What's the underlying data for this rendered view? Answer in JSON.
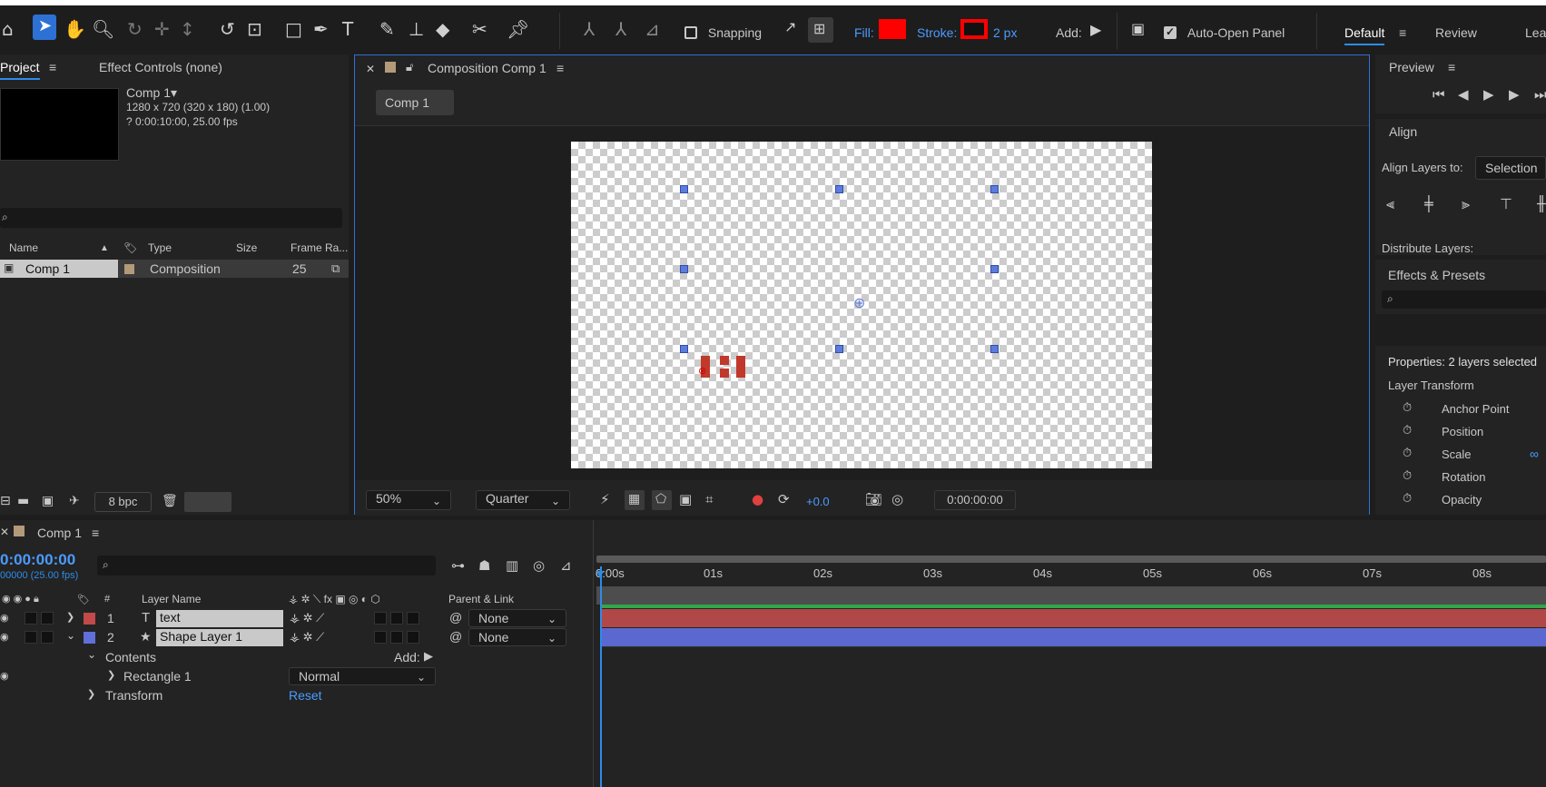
{
  "toolbar": {
    "snapping_label": "Snapping",
    "fill_label": "Fill:",
    "fill_color": "#ff0000",
    "stroke_label": "Stroke:",
    "stroke_width": "2 px",
    "add_label": "Add:",
    "auto_open_label": "Auto-Open Panel",
    "workspaces": [
      "Default",
      "Review",
      "Lea"
    ]
  },
  "project": {
    "tab_project": "Project",
    "tab_effects": "Effect Controls (none)",
    "comp_name": "Comp 1",
    "comp_info1": "1280 x 720  (320 x 180) (1.00)",
    "comp_info2": "? 0:00:10:00, 25.00 fps",
    "columns": [
      "Name",
      "Type",
      "Size",
      "Frame Ra..."
    ],
    "item": {
      "name": "Comp 1",
      "type": "Composition",
      "size": "",
      "fps": "25"
    },
    "bpc": "8 bpc"
  },
  "composition": {
    "tab": "Composition Comp 1",
    "breadcrumb": "Comp 1",
    "zoom": "50%",
    "resolution": "Quarter",
    "exposure": "+0.0",
    "timecode": "0:00:00:00"
  },
  "right": {
    "preview": "Preview",
    "align": "Align",
    "align_layers_to": "Align Layers to:",
    "align_target": "Selection",
    "distribute": "Distribute Layers:",
    "effects_presets": "Effects & Presets",
    "properties": "Properties: 2 layers selected",
    "layer_transform": "Layer Transform",
    "props": [
      "Anchor Point",
      "Position",
      "Scale",
      "Rotation",
      "Opacity"
    ]
  },
  "timeline": {
    "tab": "Comp 1",
    "timecode": "0:00:00:00",
    "frame_info": "00000 (25.00 fps)",
    "col_hash": "#",
    "col_layer_name": "Layer Name",
    "col_parent": "Parent & Link",
    "layers": [
      {
        "num": "1",
        "name": "text",
        "parent": "None",
        "color": "#c24a4a"
      },
      {
        "num": "2",
        "name": "Shape Layer 1",
        "parent": "None",
        "color": "#6070d8"
      }
    ],
    "contents_label": "Contents",
    "add_label": "Add:",
    "rect_label": "Rectangle 1",
    "blend_mode": "Normal",
    "transform_label": "Transform",
    "reset_label": "Reset",
    "ticks": [
      "0:00s",
      "01s",
      "02s",
      "03s",
      "04s",
      "05s",
      "06s",
      "07s",
      "08s"
    ]
  }
}
